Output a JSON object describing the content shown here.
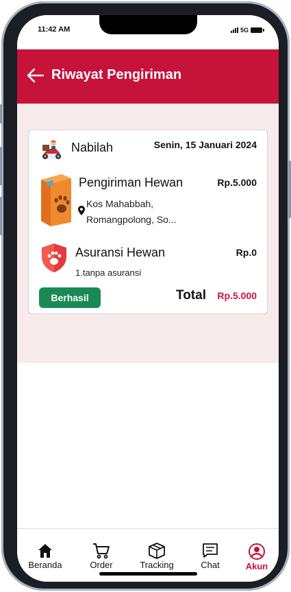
{
  "status_bar": {
    "time": "11:42 AM",
    "network": "5G"
  },
  "header": {
    "title": "Riwayat Pengiriman"
  },
  "order": {
    "customer_name": "Nabilah",
    "date": "Senin, 15 Januari 2024",
    "service_name": "Pengiriman Hewan",
    "service_price": "Rp.5.000",
    "address_line1": "Kos Mahabbah,",
    "address_line2": "Romangpolong, So...",
    "insurance_name": "Asuransi Hewan",
    "insurance_price": "Rp.0",
    "insurance_detail": "1.tanpa asuransi",
    "status": "Berhasil",
    "total_label": "Total",
    "total_value": "Rp.5.000"
  },
  "nav": {
    "items": [
      {
        "label": "Beranda",
        "icon": "home-icon"
      },
      {
        "label": "Order",
        "icon": "cart-icon"
      },
      {
        "label": "Tracking",
        "icon": "box-icon"
      },
      {
        "label": "Chat",
        "icon": "chat-icon"
      },
      {
        "label": "Akun",
        "icon": "account-icon",
        "active": true
      }
    ]
  },
  "colors": {
    "brand": "#c5133a",
    "success": "#1a8a55",
    "background_tint": "#f6eaea"
  }
}
